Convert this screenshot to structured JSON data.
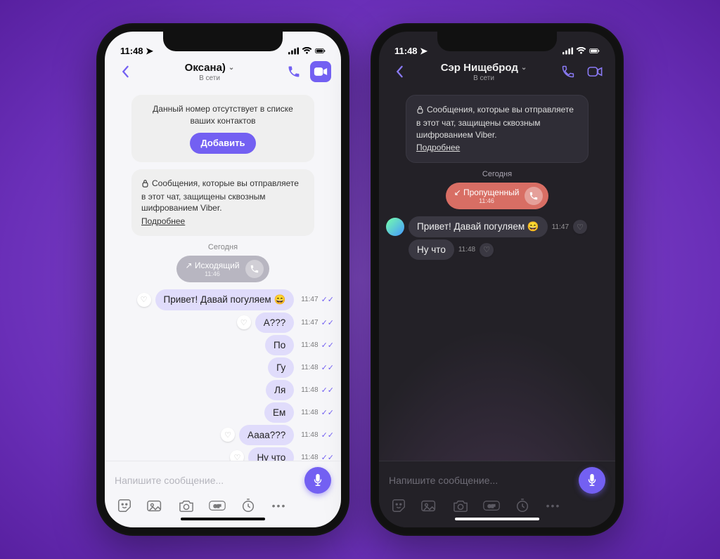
{
  "status_time": "11:48",
  "left": {
    "header": {
      "title": "Оксана)",
      "subtitle": "В сети"
    },
    "notice": {
      "text": "Данный номер отсутствует в списке ваших контактов",
      "add_label": "Добавить"
    },
    "encryption": {
      "text": "Сообщения, которые вы отправляете в этот чат, защищены сквозным шифрованием Viber.",
      "more": "Подробнее"
    },
    "date_label": "Сегодня",
    "call": {
      "label": "Исходящий",
      "time": "11:46"
    },
    "messages": [
      {
        "dir": "out",
        "text": "Привет! Давай погуляем 😄",
        "time": "11:47"
      },
      {
        "dir": "out",
        "text": "А???",
        "time": "11:47"
      },
      {
        "dir": "out",
        "text": "По",
        "time": "11:48"
      },
      {
        "dir": "out",
        "text": "Гу",
        "time": "11:48"
      },
      {
        "dir": "out",
        "text": "Ля",
        "time": "11:48"
      },
      {
        "dir": "out",
        "text": "Ем",
        "time": "11:48"
      },
      {
        "dir": "out",
        "text": "Аааа???",
        "time": "11:48"
      },
      {
        "dir": "out",
        "text": "Ну что",
        "time": "11:48"
      }
    ],
    "input_placeholder": "Напишите сообщение..."
  },
  "right": {
    "header": {
      "title": "Сэр Нищеброд",
      "subtitle": "В сети"
    },
    "encryption": {
      "text": "Сообщения, которые вы отправляете в этот чат, защищены сквозным шифрованием Viber.",
      "more": "Подробнее"
    },
    "date_label": "Сегодня",
    "call": {
      "label": "Пропущенный",
      "time": "11:46"
    },
    "messages": [
      {
        "dir": "in",
        "text": "Привет! Давай погуляем 😄",
        "time": "11:47",
        "avatar": true
      },
      {
        "dir": "in",
        "text": "Ну что",
        "time": "11:48"
      }
    ],
    "input_placeholder": "Напишите сообщение..."
  },
  "icons": {
    "dots_label": "•••"
  }
}
